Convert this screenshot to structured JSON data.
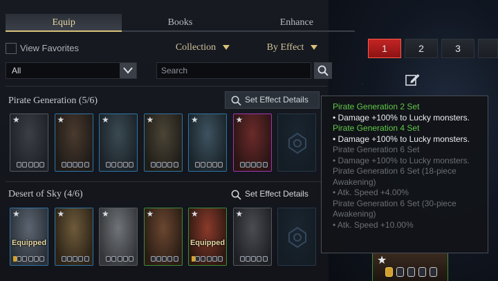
{
  "tabs": [
    {
      "label": "Equip",
      "active": true
    },
    {
      "label": "Books",
      "active": false
    },
    {
      "label": "Enhance",
      "active": false
    }
  ],
  "filters": {
    "view_favorites_label": "View Favorites",
    "collection_label": "Collection",
    "by_effect_label": "By Effect",
    "category_value": "All",
    "search_placeholder": "Search"
  },
  "groups": [
    {
      "title": "Pirate Generation (5/6)",
      "set_button_label": "Set Effect Details",
      "cards": [
        {
          "rarity": "gray",
          "equipped": false
        },
        {
          "rarity": "blue",
          "equipped": false
        },
        {
          "rarity": "blue",
          "equipped": false
        },
        {
          "rarity": "blue",
          "equipped": false
        },
        {
          "rarity": "blue",
          "equipped": false
        },
        {
          "rarity": "purple",
          "equipped": false
        },
        {
          "rarity": "empty",
          "equipped": false
        }
      ]
    },
    {
      "title": "Desert of Sky (4/6)",
      "set_button_label": "Set Effect Details",
      "equipped_label": "Equipped",
      "cards": [
        {
          "rarity": "blue",
          "equipped": true
        },
        {
          "rarity": "blue",
          "equipped": false
        },
        {
          "rarity": "gray",
          "equipped": false
        },
        {
          "rarity": "green",
          "equipped": false
        },
        {
          "rarity": "green",
          "equipped": true
        },
        {
          "rarity": "gray",
          "equipped": false
        },
        {
          "rarity": "empty",
          "equipped": false
        }
      ]
    }
  ],
  "pages": [
    "1",
    "2",
    "3"
  ],
  "active_page": "1",
  "tooltip": {
    "lines": [
      {
        "text": "Pirate Generation 2 Set",
        "style": "g"
      },
      {
        "text": "• Damage +100% to Lucky monsters.",
        "style": "w"
      },
      {
        "text": "Pirate Generation 4 Set",
        "style": "g"
      },
      {
        "text": "• Damage +100% to Lucky monsters.",
        "style": "w"
      },
      {
        "text": "Pirate Generation 6 Set",
        "style": "d"
      },
      {
        "text": "• Damage +100% to Lucky monsters.",
        "style": "d"
      },
      {
        "text": "Pirate Generation 6 Set (18-piece",
        "style": "d"
      },
      {
        "text": "Awakening)",
        "style": "d"
      },
      {
        "text": "• Atk. Speed +4.00%",
        "style": "d"
      },
      {
        "text": "Pirate Generation 6 Set (30-piece",
        "style": "d"
      },
      {
        "text": "Awakening)",
        "style": "d"
      },
      {
        "text": "• Atk. Speed +10.00%",
        "style": "d"
      }
    ]
  },
  "colors": {
    "accent_gold": "#d8c27a",
    "active_page_red": "#c32424",
    "tooltip_green": "#61c949",
    "rarity_blue": "#2f76a8",
    "rarity_green": "#3b8f3a",
    "rarity_purple": "#a238b5"
  },
  "icons": {
    "card_star": "★",
    "search": "search-icon",
    "edit": "edit-icon",
    "chevron": "chevron-down-icon"
  }
}
